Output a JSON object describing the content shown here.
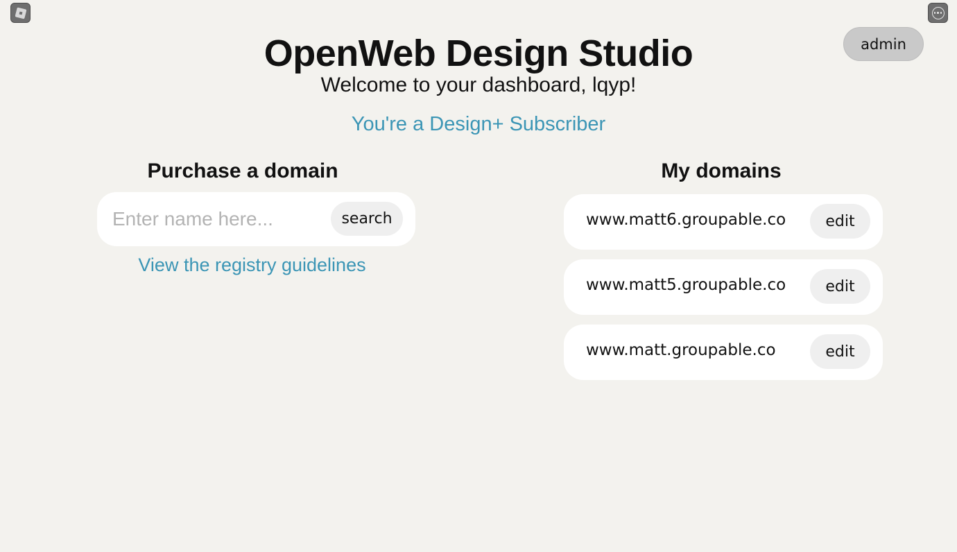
{
  "corner": {
    "left_icon": "app-logo-icon",
    "right_icon": "more-menu-icon"
  },
  "header": {
    "admin_label": "admin",
    "title": "OpenWeb Design Studio",
    "welcome": "Welcome to your dashboard, lqyp!",
    "subscriber_link": "You're a Design+ Subscriber"
  },
  "purchase": {
    "heading": "Purchase a domain",
    "placeholder": "Enter name here...",
    "value": "",
    "search_label": "search",
    "guidelines_link": "View the registry guidelines"
  },
  "domains": {
    "heading": "My domains",
    "edit_label": "edit",
    "items": [
      {
        "name": "www.matt6.groupable.co"
      },
      {
        "name": "www.matt5.groupable.co"
      },
      {
        "name": "www.matt.groupable.co"
      }
    ]
  },
  "colors": {
    "background": "#f3f2ee",
    "link": "#3b95b5",
    "card": "#ffffff",
    "button": "#efefef",
    "admin_button": "#c9c9c9"
  }
}
